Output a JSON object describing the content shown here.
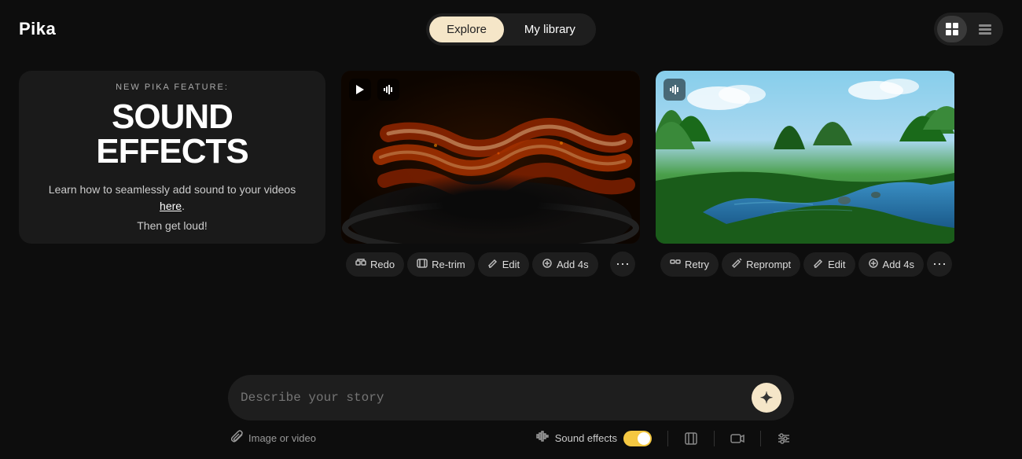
{
  "app": {
    "logo": "Pika"
  },
  "header": {
    "nav": {
      "explore_label": "Explore",
      "library_label": "My library"
    },
    "views": {
      "grid_label": "Grid view",
      "list_label": "List view"
    }
  },
  "promo": {
    "subtitle": "NEW PIKA FEATURE:",
    "title": "SOUND EFFECTS",
    "description": "Learn how to seamlessly add sound to your videos",
    "link_text": "here",
    "tagline": "Then get loud!"
  },
  "video1": {
    "actions": {
      "redo": "Redo",
      "retrim": "Re-trim",
      "edit": "Edit",
      "add4s": "Add 4s"
    }
  },
  "video2": {
    "actions": {
      "retry": "Retry",
      "reprompt": "Reprompt",
      "edit": "Edit",
      "add4s": "Add 4s"
    }
  },
  "prompt": {
    "placeholder": "Describe your story",
    "submit_icon": "✦"
  },
  "bottom_tools": {
    "attach_label": "Image or video",
    "sound_effects_label": "Sound effects",
    "icons": {
      "attach": "📎",
      "waveform": "⌇⌇",
      "expand": "⤢",
      "camera": "📹",
      "sliders": "⊟"
    }
  }
}
